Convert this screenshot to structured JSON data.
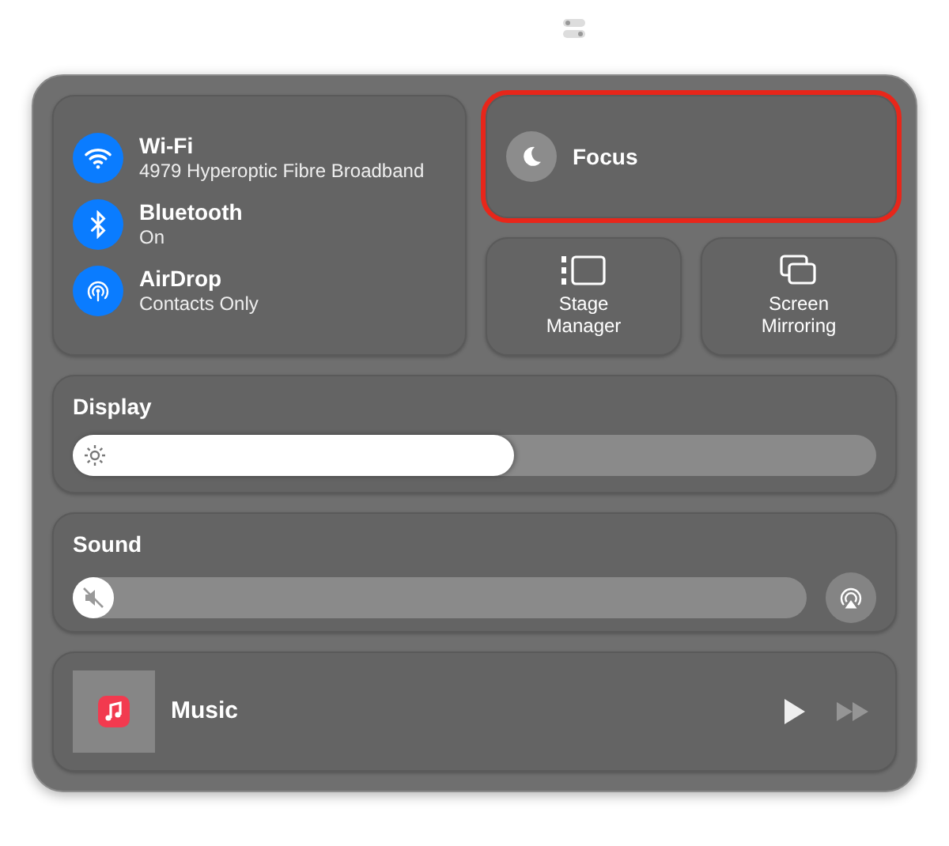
{
  "connectivity": [
    {
      "kind": "wifi",
      "title": "Wi-Fi",
      "subtitle": "4979 Hyperoptic Fibre Broadband",
      "on": true
    },
    {
      "kind": "bluetooth",
      "title": "Bluetooth",
      "subtitle": "On",
      "on": true
    },
    {
      "kind": "airdrop",
      "title": "AirDrop",
      "subtitle": "Contacts Only",
      "on": true
    }
  ],
  "focus": {
    "label": "Focus",
    "highlighted": true
  },
  "tiles": [
    {
      "kind": "stage",
      "label": "Stage Manager"
    },
    {
      "kind": "mirror",
      "label": "Screen Mirroring"
    }
  ],
  "display": {
    "title": "Display",
    "level": 0.55
  },
  "sound": {
    "title": "Sound",
    "level": 0.04,
    "muted": true
  },
  "now_playing": {
    "title": "Music",
    "forward_disabled": true
  }
}
